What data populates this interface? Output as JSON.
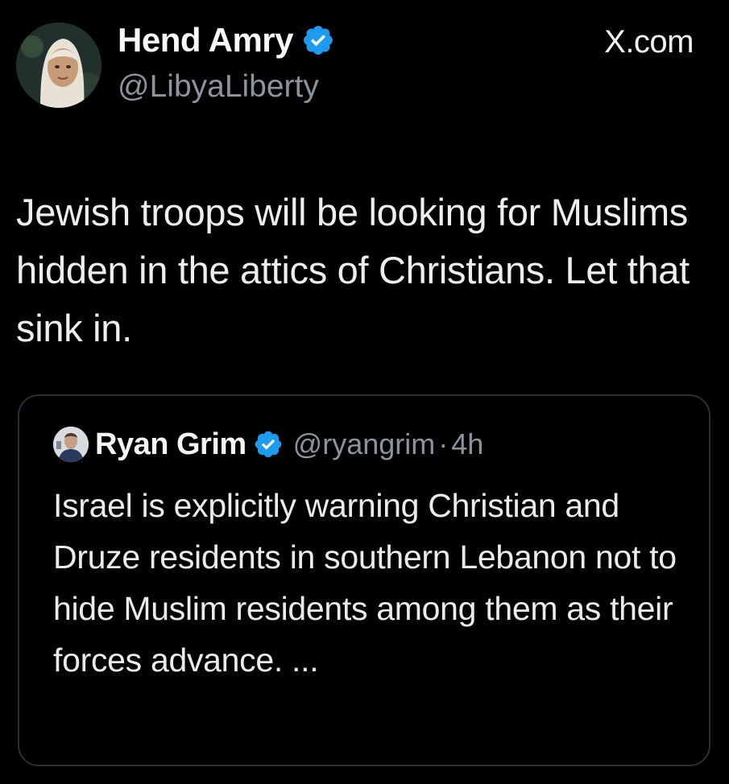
{
  "author": {
    "display_name": "Hend Amry",
    "handle": "@LibyaLiberty",
    "avatar": "profile-photo",
    "verified_icon": "verified-badge-icon"
  },
  "site_mark": "X.com",
  "tweet": {
    "text": "Jewish troops will be looking for Muslims hidden in the attics of Christians. Let that sink in."
  },
  "quoted_tweet": {
    "display_name": "Ryan Grim",
    "handle": "@ryangrim",
    "separator": "·",
    "time": "4h",
    "verified_icon": "verified-badge-icon",
    "text": "Israel is explicitly warning Christian and Druze residents in southern Lebanon not to hide Muslim residents among them as their forces advance. ..."
  },
  "colors": {
    "background": "#000000",
    "text": "#e7e9ea",
    "secondary_text": "#8b949c",
    "verified_blue": "#1d9bf0",
    "card_border": "#2b3036"
  }
}
